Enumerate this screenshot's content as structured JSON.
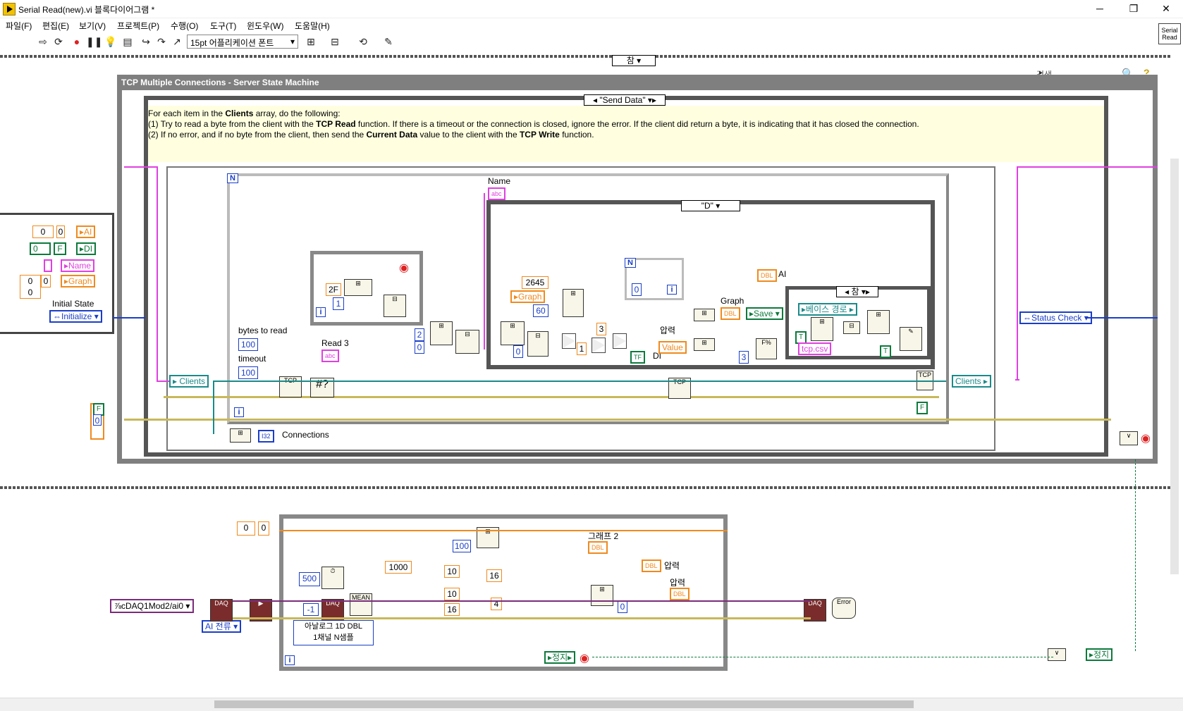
{
  "window": {
    "title": "Serial Read(new).vi 블록다이어그램 *",
    "minimize": "─",
    "restore": "❐",
    "close": "✕"
  },
  "menu": [
    "파일(F)",
    "편집(E)",
    "보기(V)",
    "프로젝트(P)",
    "수행(O)",
    "도구(T)",
    "윈도우(W)",
    "도움말(H)"
  ],
  "toolbar": {
    "font": "15pt 어플리케이션 폰트",
    "search_placeholder": "검색",
    "vi_icon_line1": "Serial",
    "vi_icon_line2": "Read"
  },
  "outer_case": {
    "selector": "참"
  },
  "frame": {
    "title": "TCP Multiple Connections - Server State Machine"
  },
  "state_case": {
    "selector": "\"Send Data\"",
    "comment_line1_a": "For each item in the ",
    "comment_line1_b": "Clients",
    "comment_line1_c": " array, do the following:",
    "comment_line2_a": "(1) Try to read a byte from the client with the ",
    "comment_line2_b": "TCP Read",
    "comment_line2_c": " function. If there is a timeout or the connection is closed, ignore the error. If the client did return a byte, it is indicating that it has closed the connection.",
    "comment_line3_a": "(2) If no error, and if no byte from the client, then send the ",
    "comment_line3_b": "Current Data",
    "comment_line3_c": " value to the client with the ",
    "comment_line3_d": "TCP Write",
    "comment_line3_e": " function."
  },
  "left_cluster": {
    "ai": "AI",
    "di": "DI",
    "name": "Name",
    "graph": "Graph",
    "initial_state_label": "Initial State",
    "initial_state_value": "Initialize",
    "zero": "0",
    "f": "F"
  },
  "for_loop": {
    "n": "N",
    "i": "i",
    "clients_in": "Clients",
    "clients_out": "Clients",
    "bytes_to_read_label": "bytes to read",
    "bytes_to_read": "100",
    "timeout_label": "timeout",
    "timeout": "100",
    "read3_label": "Read 3",
    "name_label": "Name",
    "connections_label": "Connections",
    "const_2": "2",
    "const_0": "0",
    "const_2f": "2F",
    "const_1": "1",
    "f": "F"
  },
  "inner_case": {
    "selector": "\"D\"",
    "graph": "Graph",
    "c2645": "2645",
    "c60": "60",
    "c0": "0",
    "c1": "1",
    "c3": "3",
    "ai_label": "AI",
    "di_label": "DI",
    "pressure_label": "압력",
    "value": "Value",
    "graph_label": "Graph",
    "save": "Save",
    "c3b": "3",
    "true_case": "참",
    "base_path": "베이스 경로",
    "file": "tcp.csv",
    "t": "T",
    "n": "N",
    "i": "i",
    "c0b": "0"
  },
  "right_side": {
    "status_check": "Status Check"
  },
  "daq": {
    "zero": "0",
    "channel": "cDAQ1Mod2/ai0",
    "ai_current": "AI 전류",
    "c500": "500",
    "cm1": "-1",
    "mean": "MEAN",
    "analog_line1": "아날로그 1D DBL",
    "analog_line2": "1채널 N샘플",
    "c100": "100",
    "c1000": "1000",
    "c10a": "10",
    "c16a": "16",
    "c10b": "10",
    "c16b": "16",
    "c4": "4",
    "c0": "0",
    "graph2_label": "그래프 2",
    "pressure1": "압력",
    "pressure2": "압력",
    "dbl": "DBL",
    "stop": "정지",
    "stop2": "정지",
    "i": "i",
    "error": "Error"
  },
  "colors": {
    "pink": "#e040e0",
    "orange": "#f08a1e",
    "blue": "#1a3ec8",
    "green": "#0d7a3c",
    "frame_gray": "#777777",
    "comment_bg": "#ffffe0"
  }
}
